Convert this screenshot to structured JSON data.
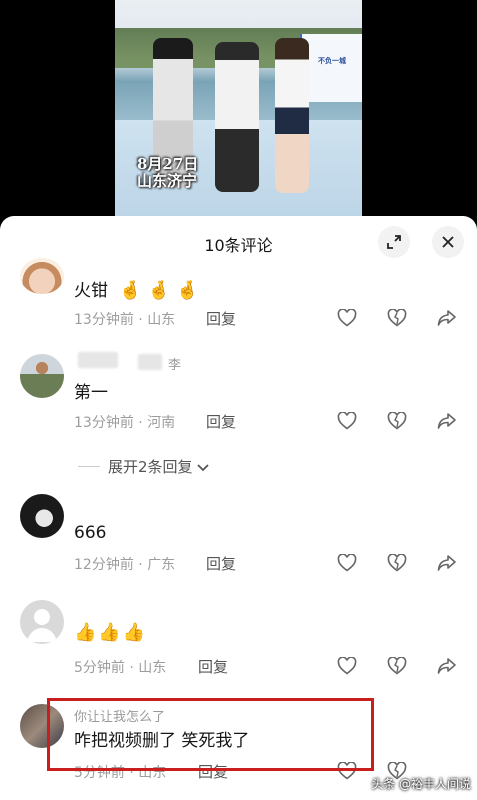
{
  "video": {
    "caption_line1": "8月27日",
    "caption_line2": "山东济宁",
    "banner_text": "不负一城"
  },
  "sheet": {
    "title": "10条评论"
  },
  "comments": [
    {
      "text": "火钳",
      "emoji": [
        "🤞",
        "🤞",
        "🤞"
      ],
      "time": "13分钟前",
      "sep": "·",
      "location": "山东",
      "reply_label": "回复"
    },
    {
      "name_suffix": "李",
      "text": "第一",
      "time": "13分钟前",
      "sep": "·",
      "location": "河南",
      "reply_label": "回复"
    },
    {
      "text": "666",
      "time": "12分钟前",
      "sep": "·",
      "location": "广东",
      "reply_label": "回复"
    },
    {
      "emoji": [
        "👍",
        "👍",
        "👍"
      ],
      "time": "5分钟前",
      "sep": "·",
      "location": "山东",
      "reply_label": "回复"
    },
    {
      "name": "你让让我怎么了",
      "text": "咋把视频删了 笑死我了",
      "time": "5分钟前",
      "sep": "·",
      "location": "山东",
      "reply_label": "回复"
    }
  ],
  "expand_replies": {
    "label": "展开2条回复"
  },
  "watermark": {
    "text": "头条 @裕丰人间说"
  },
  "colors": {
    "highlight": "#c81e1e",
    "meta_text": "#9d9d9d",
    "sheet_bg": "#ffffff"
  },
  "icons": [
    "expand-icon",
    "close-icon",
    "heart-icon",
    "broken-heart-icon",
    "share-arrow-icon",
    "chevron-down-icon"
  ]
}
